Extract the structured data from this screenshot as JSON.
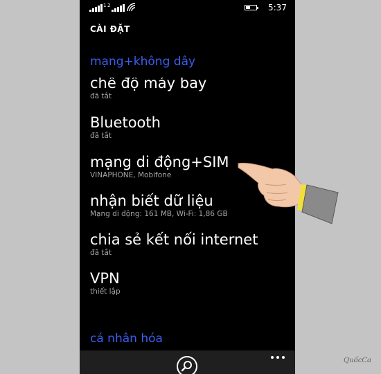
{
  "status_bar": {
    "sim1_label": "1",
    "sim2_label": "2",
    "time": "5:37",
    "battery_level": 0.4
  },
  "header": {
    "title": "CÀI ĐẶT"
  },
  "sections": {
    "network": "mạng+không dây",
    "personalization": "cá nhân hóa"
  },
  "items": [
    {
      "title": "chế độ máy bay",
      "subtitle": "đã tắt"
    },
    {
      "title": "Bluetooth",
      "subtitle": "đã tắt"
    },
    {
      "title": "mạng di động+SIM",
      "subtitle": "VINAPHONE, Mobifone"
    },
    {
      "title": "nhận biết dữ liệu",
      "subtitle": "Mạng di động: 161 MB, Wi-Fi: 1,86 GB"
    },
    {
      "title": "chia sẻ kết nối internet",
      "subtitle": "đã tắt"
    },
    {
      "title": "VPN",
      "subtitle": "thiết lập"
    }
  ],
  "icons": {
    "search": "search-icon",
    "more": "more-icon",
    "signal": "signal-icon",
    "wifi": "wifi-icon",
    "battery": "battery-icon"
  },
  "colors": {
    "accent": "#3a5ff0",
    "background": "#000000",
    "subtitle": "#a5a5a5",
    "appbar": "#1f1f1f"
  },
  "watermark": "QuốcCa"
}
